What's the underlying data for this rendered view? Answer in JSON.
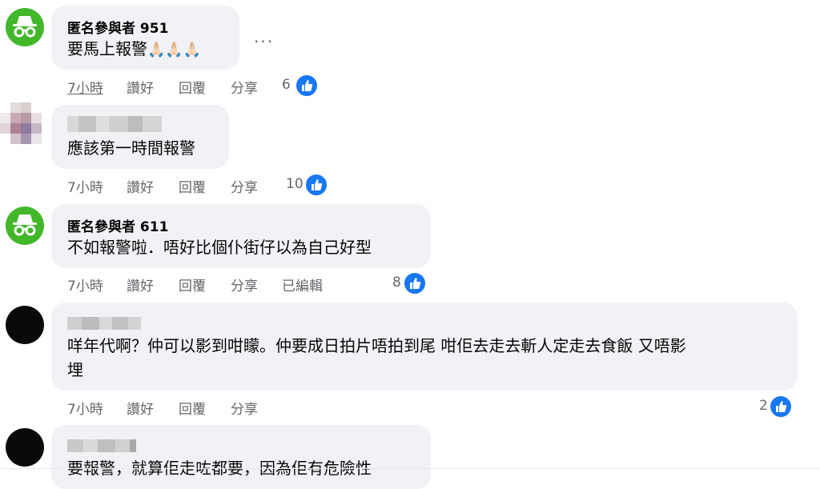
{
  "comments": [
    {
      "author": "匿名參與者 951",
      "text": "要馬上報警",
      "emoji": "🙏🏻🙏🏻🙏🏻",
      "time": "7小時",
      "like": "讚好",
      "reply": "回覆",
      "share": "分享",
      "likes": "6"
    },
    {
      "author": "",
      "text": "應該第一時間報警",
      "time": "7小時",
      "like": "讚好",
      "reply": "回覆",
      "share": "分享",
      "likes": "10"
    },
    {
      "author": "匿名參與者 611",
      "text": "不如報警啦．唔好比個仆街仔以為自己好型",
      "time": "7小時",
      "like": "讚好",
      "reply": "回覆",
      "share": "分享",
      "edited": "已編輯",
      "likes": "8"
    },
    {
      "author": "",
      "text_line1": "咩年代啊？仲可以影到咁矇。仲要成日拍片唔拍到尾 咁佢去走去斬人定走去食飯 又唔影",
      "text_line2": "埋",
      "time": "7小時",
      "like": "讚好",
      "reply": "回覆",
      "share": "分享",
      "likes": "2"
    },
    {
      "author": "",
      "text": "要報警，就算佢走咗都要，因為佢有危險性"
    }
  ],
  "more_label": "···",
  "colors": {
    "like_blue": "#1877f2",
    "anon_green": "#42b72a",
    "bubble": "#f0f2f5",
    "meta": "#65676b"
  }
}
